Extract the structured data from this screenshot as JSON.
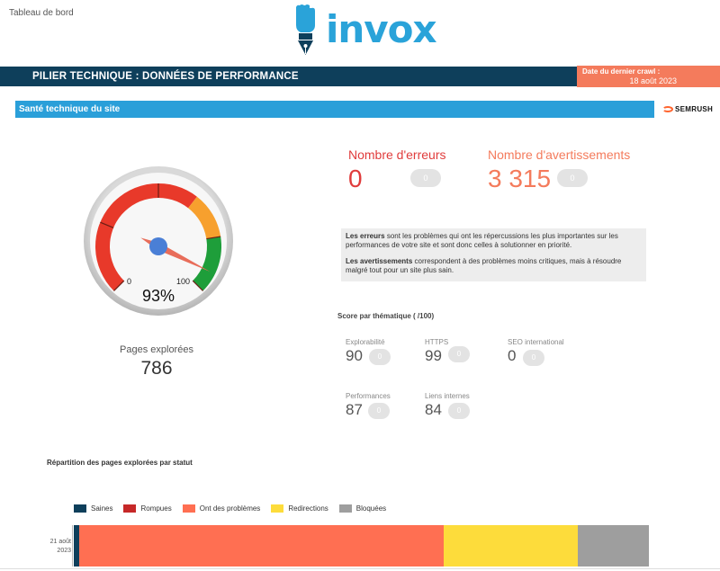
{
  "breadcrumb": "Tableau de bord",
  "brand": {
    "name": "invox",
    "color": "#2AA3D9"
  },
  "banner": {
    "title": "PILIER TECHNIQUE : DONNÉES DE PERFORMANCE",
    "crawl_label": "Date du dernier crawl :",
    "crawl_date": "18 août 2023"
  },
  "section": {
    "title": "Santé technique du site",
    "provider": "SEMRUSH"
  },
  "gauge": {
    "value_label": "93%",
    "value": 93,
    "min": "0",
    "max": "100"
  },
  "pages": {
    "label": "Pages explorées",
    "value": "786"
  },
  "errors": {
    "label": "Nombre d'erreurs",
    "value": "0",
    "delta": "0"
  },
  "warnings": {
    "label": "Nombre d'avertissements",
    "value": "3 315",
    "delta": "0"
  },
  "info": {
    "p1_bold": "Les erreurs",
    "p1_text": " sont les problèmes qui ont les répercussions les plus importantes sur les performances de votre site et sont donc celles à solutionner en priorité.",
    "p2_bold": "Les avertissements",
    "p2_text": " correspondent à des problèmes moins critiques, mais à résoudre malgré tout pour un site plus sain."
  },
  "scores": {
    "title": "Score par thématique ( /100)",
    "items": [
      {
        "label": "Explorabilité",
        "value": "90",
        "delta": "0"
      },
      {
        "label": "HTTPS",
        "value": "99",
        "delta": "0"
      },
      {
        "label": "SEO international",
        "value": "0",
        "delta": "0"
      },
      {
        "label": "Performances",
        "value": "87",
        "delta": "0"
      },
      {
        "label": "Liens internes",
        "value": "84",
        "delta": "0"
      }
    ]
  },
  "chart_data": {
    "type": "bar",
    "orientation": "horizontal",
    "stacked": true,
    "title": "Répartition des pages explorées par statut",
    "categories": [
      "21 août 2023"
    ],
    "series": [
      {
        "name": "Saines",
        "values": [
          7
        ],
        "color": "#0E3F5B"
      },
      {
        "name": "Rompues",
        "values": [
          0
        ],
        "color": "#C62828"
      },
      {
        "name": "Ont des problèmes",
        "values": [
          479
        ],
        "color": "#FF6F52"
      },
      {
        "name": "Redirections",
        "values": [
          176
        ],
        "color": "#FDDC3B"
      },
      {
        "name": "Bloquées",
        "values": [
          94
        ],
        "color": "#9E9E9E"
      }
    ],
    "legend": "top-left",
    "grid": false
  }
}
